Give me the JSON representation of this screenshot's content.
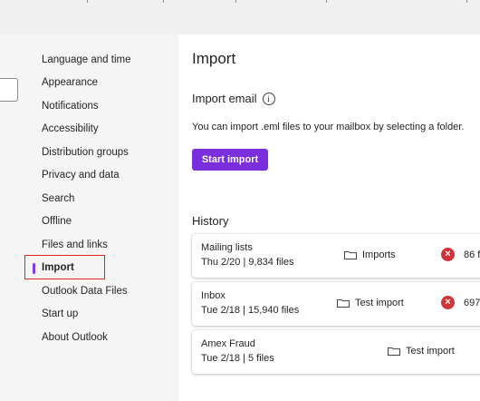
{
  "nav": {
    "items": [
      {
        "label": "Language and time"
      },
      {
        "label": "Appearance"
      },
      {
        "label": "Notifications"
      },
      {
        "label": "Accessibility"
      },
      {
        "label": "Distribution groups"
      },
      {
        "label": "Privacy and data"
      },
      {
        "label": "Search"
      },
      {
        "label": "Offline"
      },
      {
        "label": "Files and links"
      },
      {
        "label": "Import"
      },
      {
        "label": "Outlook Data Files"
      },
      {
        "label": "Start up"
      },
      {
        "label": "About Outlook"
      }
    ],
    "selected": "Import"
  },
  "main": {
    "title": "Import",
    "import_email": {
      "heading": "Import email",
      "description": "You can import .eml files to your mailbox by selecting a folder.",
      "button_label": "Start import"
    },
    "history": {
      "heading": "History",
      "rows": [
        {
          "name": "Mailing lists",
          "meta": "Thu 2/20 | 9,834 files",
          "folder": "Imports",
          "status": "error",
          "count": "86 f"
        },
        {
          "name": "Inbox",
          "meta": "Tue 2/18 | 15,940 files",
          "folder": "Test import",
          "status": "error",
          "count": "697"
        },
        {
          "name": "Amex Fraud",
          "meta": "Tue 2/18 | 5 files",
          "folder": "Test import",
          "status": "none",
          "count": ""
        }
      ]
    }
  },
  "colors": {
    "accent": "#7b2fdc",
    "error": "#d13438",
    "highlight": "#e02424"
  }
}
